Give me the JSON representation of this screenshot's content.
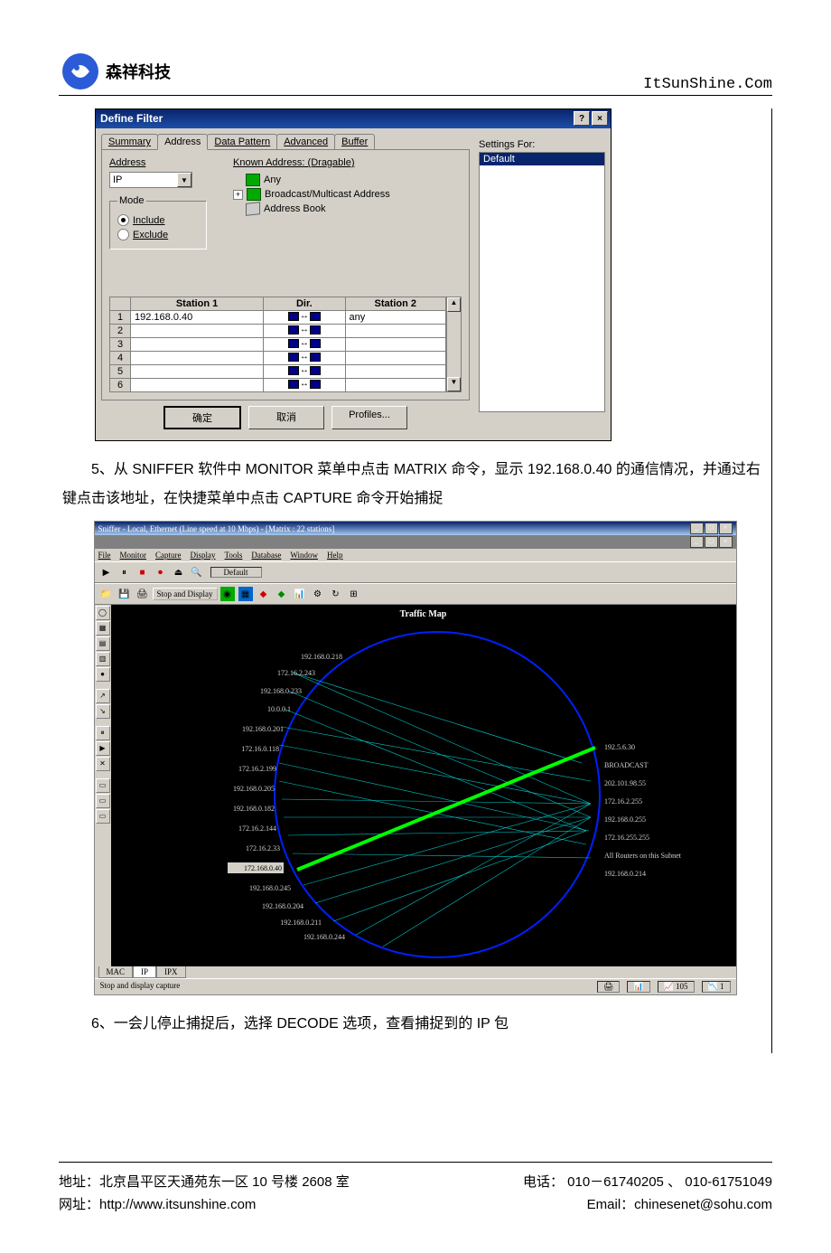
{
  "header": {
    "company": "森祥科技",
    "site": "ItSunShine.Com"
  },
  "dialog": {
    "title": "Define Filter",
    "tabs": [
      "Summary",
      "Address",
      "Data Pattern",
      "Advanced",
      "Buffer"
    ],
    "active_tab": 1,
    "address_label": "Address",
    "combo_value": "IP",
    "mode_legend": "Mode",
    "mode_include": "Include",
    "mode_exclude": "Exclude",
    "known_label": "Known Address: (Dragable)",
    "tree": [
      "Any",
      "Broadcast/Multicast Address",
      "Address Book"
    ],
    "table": {
      "headers": [
        "Station 1",
        "Dir.",
        "Station 2"
      ],
      "rows": [
        {
          "n": "1",
          "s1": "192.168.0.40",
          "s2": "any"
        },
        {
          "n": "2",
          "s1": "",
          "s2": ""
        },
        {
          "n": "3",
          "s1": "",
          "s2": ""
        },
        {
          "n": "4",
          "s1": "",
          "s2": ""
        },
        {
          "n": "5",
          "s1": "",
          "s2": ""
        },
        {
          "n": "6",
          "s1": "",
          "s2": ""
        }
      ]
    },
    "settings_for": "Settings For:",
    "settings_value": "Default",
    "btn_ok": "确定",
    "btn_cancel": "取消",
    "btn_profiles": "Profiles..."
  },
  "para5": "5、从 SNIFFER 软件中 MONITOR 菜单中点击 MATRIX 命令，显示 192.168.0.40 的通信情况，并通过右键点击该地址，在快捷菜单中点击 CAPTURE 命令开始捕捉",
  "matrix": {
    "title": "Sniffer - Local, Ethernet (Line speed at 10 Mbps) - [Matrix : 22 stations]",
    "menu": [
      "File",
      "Monitor",
      "Capture",
      "Display",
      "Tools",
      "Database",
      "Window",
      "Help"
    ],
    "tb_default": "Default",
    "tb_stop": "Stop and Display",
    "traffic_map": "Traffic Map",
    "left_nodes": [
      "192.168.0.218",
      "172.16.2.243",
      "192.168.0.233",
      "10.0.0.1",
      "192.168.0.201",
      "172.16.0.118",
      "172.16.2.199",
      "192.168.0.205",
      "192.168.0.182",
      "172.16.2.144",
      "172.16.2.33",
      "172.168.0.40",
      "192.168.0.245",
      "192.168.0.204",
      "192.168.0.211",
      "192.168.0.244"
    ],
    "right_nodes": [
      "192.5.6.30",
      "BROADCAST",
      "202.101.98.55",
      "172.16.2.255",
      "192.168.0.255",
      "172.16.255.255",
      "All Routers on this Subnet",
      "192.168.0.214"
    ],
    "selected_node": "172.168.0.40",
    "tabs": [
      "MAC",
      "IP",
      "IPX"
    ],
    "status": "Stop and display capture",
    "stat_a": "105",
    "stat_b": "1"
  },
  "para6": "6、一会儿停止捕捉后，选择 DECODE 选项，查看捕捉到的 IP 包",
  "footer": {
    "addr_l": "地址：北京昌平区天通苑东一区 10 号楼 2608 室",
    "tel": "电话： 010－61740205 、 010-61751049",
    "web": "网址：http://www.itsunshine.com",
    "email": "Email：chinesenet@sohu.com"
  }
}
